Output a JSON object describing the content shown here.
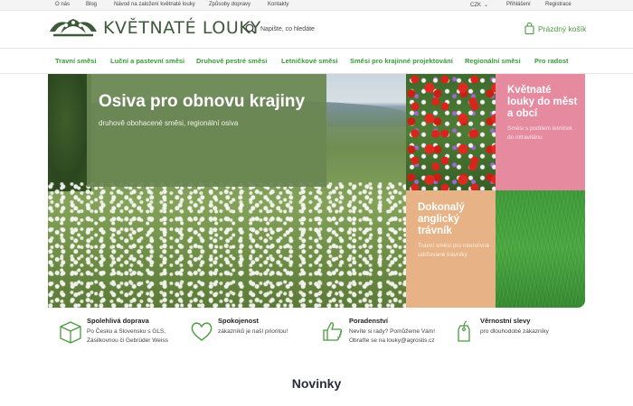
{
  "topbar": {
    "links": [
      "O nás",
      "Blog",
      "Návod na založení květnaté louky",
      "Způsoby dopravy",
      "Kontakty"
    ],
    "currency": "CZK",
    "login": "Přihlášení",
    "register": "Registrace"
  },
  "header": {
    "logo_text": "KVĚTNATÉ LOUKY",
    "search_placeholder": "Napište, co hledáte",
    "cart_label": "Prázdný košík"
  },
  "nav": {
    "items": [
      "Travní směsi",
      "Luční a pastevní směsi",
      "Druhově pestré směsi",
      "Letničkové směsi",
      "Směsi pro krajinné projektování",
      "Regionální směsi",
      "Pro radost"
    ]
  },
  "hero": {
    "title": "Osiva pro obnovu krajiny",
    "subtitle": "druhově obohacené směsi, regionální osiva"
  },
  "tiles": {
    "pink": {
      "title": "Květnaté louky do měst a obcí",
      "desc": "Směsi s podílem letniček do intravilánu"
    },
    "tan": {
      "title": "Dokonalý anglický trávník",
      "desc": "Travní směsi pro intenzivně udržované trávníky"
    }
  },
  "features": [
    {
      "title": "Spolehlivá doprava",
      "line1": "Po Česku a Slovensku s GLS,",
      "line2": "Zásilkovnou či Gebrüder Weiss",
      "icon": "box-icon"
    },
    {
      "title": "Spokojenost",
      "line1": "zákazníků je naší prioritou!",
      "line2": "",
      "icon": "heart-icon"
    },
    {
      "title": "Poradenství",
      "line1": "Nevíte si rady? Pomůžeme Vám!",
      "line2": "Obraťte se na louky@agrostis.cz",
      "icon": "thumbs-up-icon"
    },
    {
      "title": "Věrnostní slevy",
      "line1": "pro dlouhodobé zákazníky",
      "line2": "",
      "icon": "price-tag-icon"
    }
  ],
  "section": {
    "title": "Novinky"
  },
  "colors": {
    "accent": "#3a9a3a",
    "hero_box": "#6a8752",
    "pink": "#e68aa0",
    "tan": "#e7b386"
  }
}
